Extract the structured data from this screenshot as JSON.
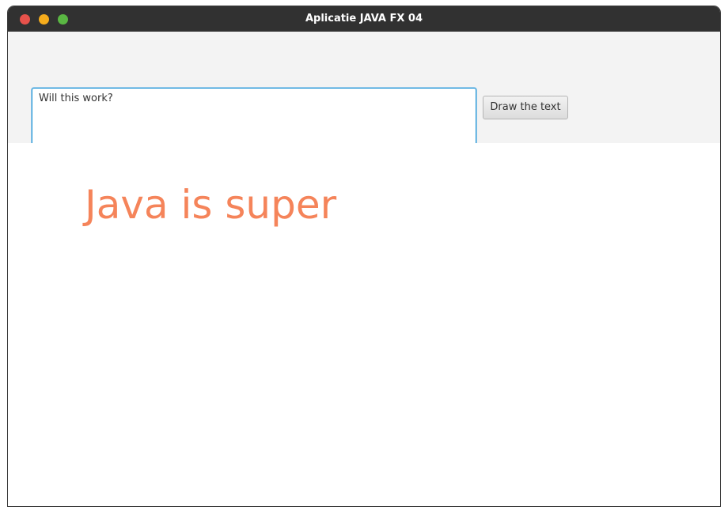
{
  "window": {
    "title": "Aplicatie JAVA FX 04",
    "controls": {
      "close_color": "#e7524b",
      "minimize_color": "#f5ac1c",
      "maximize_color": "#5ab743"
    }
  },
  "input": {
    "value": "Will this work?"
  },
  "button": {
    "label": "Draw the text"
  },
  "canvas": {
    "text": "Java is super",
    "text_color": "#f5845a"
  }
}
